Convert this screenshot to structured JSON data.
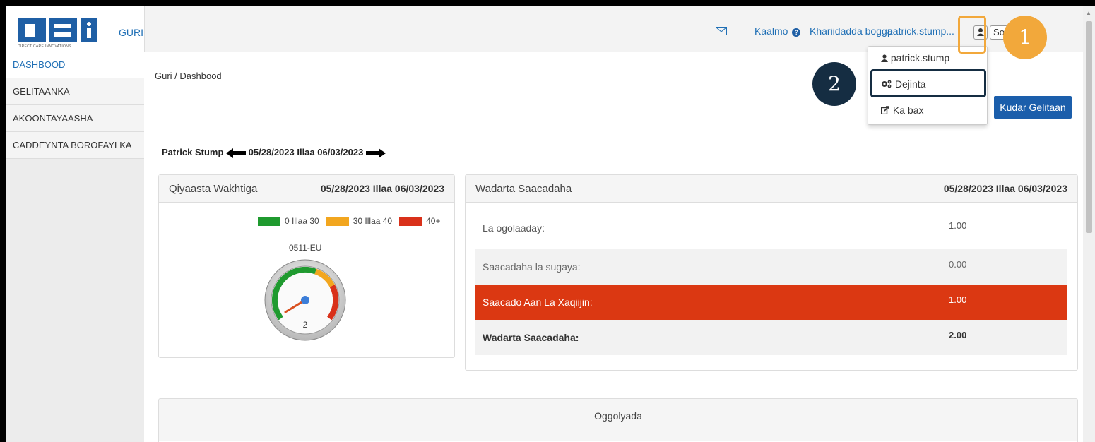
{
  "header": {
    "logo_text": "DCI",
    "logo_subtitle": "DIRECT CARE INNOVATIONS",
    "home_link": "GURI",
    "help_label": "Kaalmo",
    "site_map_label": "Khariidadda bogga",
    "username": "patrick.stump",
    "signout_partial": "So"
  },
  "sidebar": {
    "items": [
      {
        "label": "DASHBOOD",
        "active": true
      },
      {
        "label": "GELITAANKA"
      },
      {
        "label": "AKOONTAYAASHA"
      },
      {
        "label": "CADDEYNTA BOROFAYLKA"
      }
    ]
  },
  "main": {
    "breadcrumb": "Guri / Dashbood",
    "add_entry_button": "Kudar Gelitaan",
    "person_name": "Patrick Stump",
    "period_range": "05/28/2023 Illaa 06/03/2023"
  },
  "time_gauge_panel": {
    "title": "Qiyaasta Wakhtiga",
    "date_range": "05/28/2023 Illaa 06/03/2023",
    "legend": [
      {
        "label": "0 Illaa 30",
        "color": "#1f9a2f"
      },
      {
        "label": "30 Illaa 40",
        "color": "#f2a61f"
      },
      {
        "label": "40+",
        "color": "#d9311a"
      }
    ],
    "gauge_label": "0511-EU",
    "gauge_value": "2",
    "gauge_max": 50
  },
  "total_hours_panel": {
    "title": "Wadarta Saacadaha",
    "date_range": "05/28/2023 Illaa 06/03/2023",
    "rows": [
      {
        "label": "La ogolaaday:",
        "value": "1.00"
      },
      {
        "label": "Saacadaha la sugaya:",
        "value": "0.00"
      },
      {
        "label": "Saacado Aan La Xaqiijin:",
        "value": "1.00"
      },
      {
        "label": "Wadarta Saacadaha:",
        "value": "2.00"
      }
    ]
  },
  "approvals_panel": {
    "title": "Oggolyada"
  },
  "user_menu": {
    "items": [
      {
        "label": "patrick.stump",
        "icon": "user-icon"
      },
      {
        "label": "Dejinta",
        "icon": "gears-icon"
      },
      {
        "label": "Ka bax",
        "icon": "sign-out-icon"
      }
    ]
  },
  "callouts": {
    "step1": "1",
    "step2": "2",
    "step1_color": "#f2a83b",
    "step2_color": "#152d42"
  }
}
